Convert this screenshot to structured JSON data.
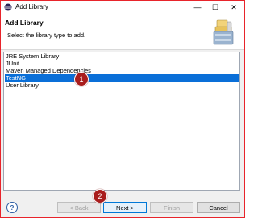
{
  "window": {
    "title": "Add Library",
    "minimize_glyph": "—",
    "maximize_glyph": "☐",
    "close_glyph": "✕"
  },
  "header": {
    "title": "Add Library",
    "description": "Select the library type to add."
  },
  "library_types": [
    {
      "label": "JRE System Library",
      "selected": false
    },
    {
      "label": "JUnit",
      "selected": false
    },
    {
      "label": "Maven Managed Dependencies",
      "selected": false
    },
    {
      "label": "TestNG",
      "selected": true
    },
    {
      "label": "User Library",
      "selected": false
    }
  ],
  "step_markers": [
    "1",
    "2"
  ],
  "footer": {
    "help_glyph": "?",
    "back_label": "< Back",
    "next_label": "Next >",
    "finish_label": "Finish",
    "cancel_label": "Cancel"
  },
  "colors": {
    "selection": "#0a6fd8",
    "marker": "#a91d1d",
    "window_border": "#e8242b"
  }
}
